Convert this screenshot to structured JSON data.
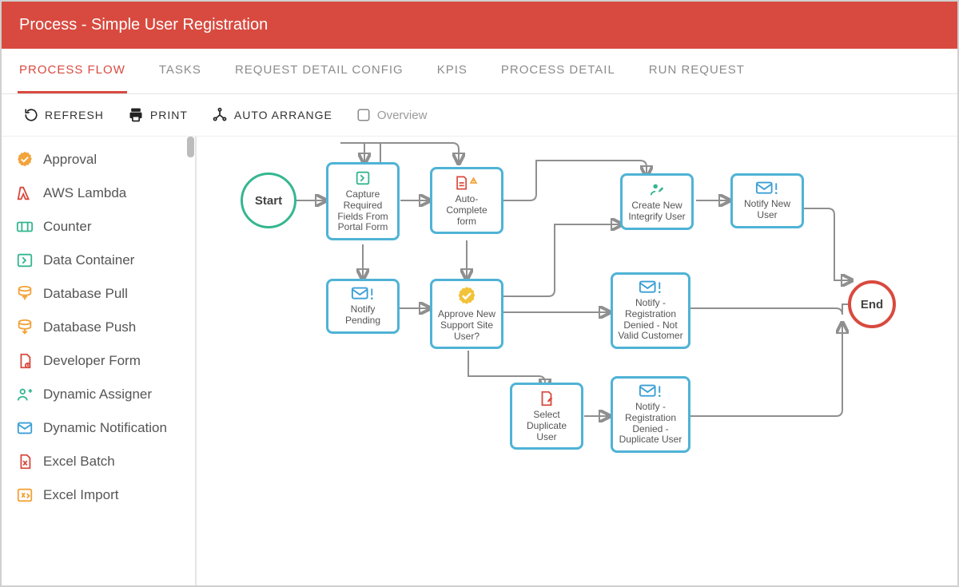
{
  "header": {
    "title": "Process - Simple User Registration"
  },
  "tabs": [
    {
      "label": "PROCESS FLOW",
      "active": true
    },
    {
      "label": "TASKS"
    },
    {
      "label": "REQUEST DETAIL CONFIG"
    },
    {
      "label": "KPIS"
    },
    {
      "label": "PROCESS DETAIL"
    },
    {
      "label": "RUN REQUEST"
    }
  ],
  "toolbar": {
    "refresh": "REFRESH",
    "print": "PRINT",
    "auto_arrange": "AUTO ARRANGE",
    "overview": "Overview"
  },
  "sidebar": {
    "items": [
      {
        "label": "Approval",
        "icon": "approval"
      },
      {
        "label": "AWS Lambda",
        "icon": "lambda"
      },
      {
        "label": "Counter",
        "icon": "counter"
      },
      {
        "label": "Data Container",
        "icon": "data-container"
      },
      {
        "label": "Database Pull",
        "icon": "db-pull"
      },
      {
        "label": "Database Push",
        "icon": "db-push"
      },
      {
        "label": "Developer Form",
        "icon": "dev-form"
      },
      {
        "label": "Dynamic Assigner",
        "icon": "assigner"
      },
      {
        "label": "Dynamic Notification",
        "icon": "notification"
      },
      {
        "label": "Excel Batch",
        "icon": "excel-batch"
      },
      {
        "label": "Excel Import",
        "icon": "excel-import"
      }
    ]
  },
  "flow": {
    "start_label": "Start",
    "end_label": "End",
    "nodes": {
      "capture": "Capture Required Fields From Portal Form",
      "autocomplete": "Auto-Complete form",
      "create_user": "Create New Integrify User",
      "notify_new": "Notify New User",
      "notify_pending": "Notify Pending",
      "approve": "Approve New Support Site User?",
      "reg_denied_invalid": "Notify - Registration Denied - Not Valid Customer",
      "select_duplicate": "Select Duplicate User",
      "reg_denied_dup": "Notify - Registration Denied - Duplicate User"
    }
  }
}
